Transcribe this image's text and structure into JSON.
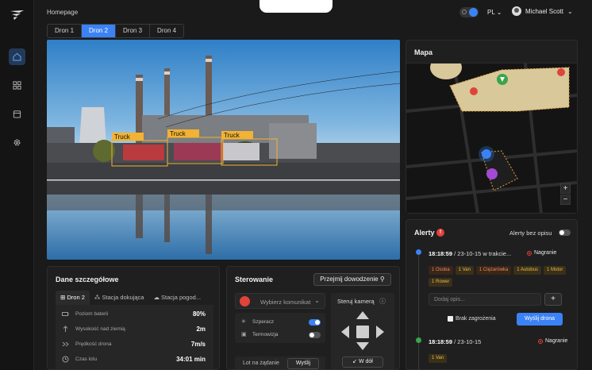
{
  "breadcrumb": "Homepage",
  "language": "PL",
  "user_name": "Michael Scott",
  "drone_tabs": [
    {
      "label": "Dron 1",
      "active": false
    },
    {
      "label": "Dron 2",
      "active": true
    },
    {
      "label": "Dron 3",
      "active": false
    },
    {
      "label": "Dron 4",
      "active": false
    }
  ],
  "video": {
    "detections": [
      "Truck",
      "Truck",
      "Truck"
    ]
  },
  "map": {
    "title": "Mapa",
    "zoom_in": "+",
    "zoom_out": "−"
  },
  "alerts": {
    "title": "Alerty",
    "badge": "!",
    "toggle_label": "Alerty bez opisu",
    "items": [
      {
        "time": "18:18:59",
        "date_text": " / 23-10-15 w trakcie...",
        "recording": "Nagranie",
        "tags": [
          "1 Osoba",
          "1 Van",
          "1 Ciężarówka",
          "1 Autobus",
          "1 Motor",
          "1 Rower"
        ],
        "desc_placeholder": "Dodaj opis...",
        "add_btn": "+",
        "no_threat_label": "Brak zagrożenia",
        "send_btn": "Wyślij drona"
      },
      {
        "time": "18:18:59",
        "date_text": " / 23-10-15",
        "recording": "Nagranie",
        "tags": [
          "1 Van"
        ]
      }
    ]
  },
  "details": {
    "title": "Dane szczegółowe",
    "tabs": [
      "Dron 2",
      "Stacja dokująca",
      "Stacja pogod..."
    ],
    "rows": [
      {
        "label": "Poziom baterii",
        "value": "80%"
      },
      {
        "label": "Wysokość nad ziemią",
        "value": "2m"
      },
      {
        "label": "Prędkość drona",
        "value": "7m/s"
      },
      {
        "label": "Czas lotu",
        "value": "34:01 min"
      }
    ]
  },
  "control": {
    "title": "Sterowanie",
    "takeover_btn": "Przejmij dowodzenie",
    "message_placeholder": "Wybierz komunikat",
    "options": [
      {
        "label": "Szperacz",
        "on": true
      },
      {
        "label": "Termowizja",
        "on": false
      }
    ],
    "mode_label": "Lot na żądanie",
    "send_btn": "Wyślij",
    "camera_title": "Steruj kamerą",
    "down_btn": "W dół"
  },
  "colors": {
    "accent": "#3b82f6",
    "danger": "#e0433a",
    "warning": "#e8b94a",
    "detection": "#f2b233"
  }
}
